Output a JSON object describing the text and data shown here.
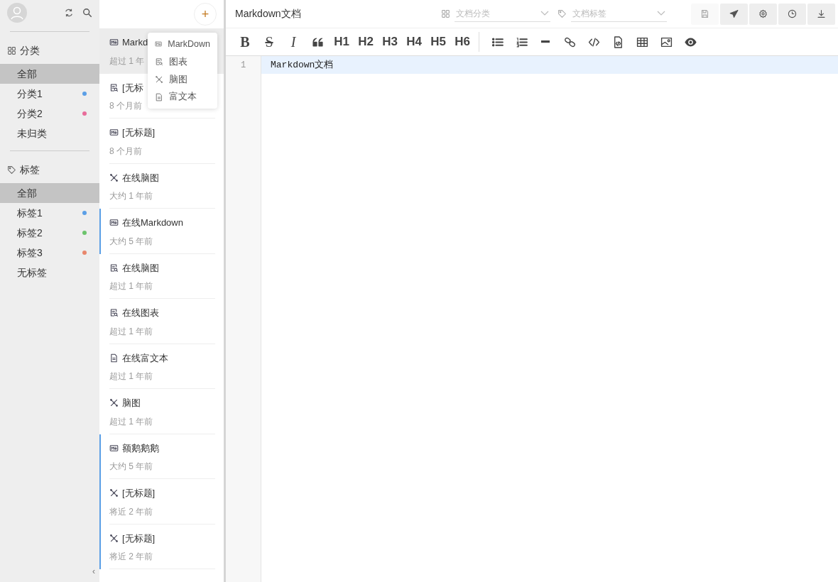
{
  "sidebar": {
    "sections": [
      {
        "kind": "category",
        "title": "分类",
        "items": [
          {
            "label": "全部",
            "selected": true
          },
          {
            "label": "分类1",
            "selected": false,
            "color": "#5b9fe6"
          },
          {
            "label": "分类2",
            "selected": false,
            "color": "#e86c9a"
          },
          {
            "label": "未归类",
            "selected": false
          }
        ]
      },
      {
        "kind": "tag",
        "title": "标签",
        "items": [
          {
            "label": "全部",
            "selected": true
          },
          {
            "label": "标签1",
            "selected": false,
            "color": "#5b9fe6"
          },
          {
            "label": "标签2",
            "selected": false,
            "color": "#6cc46c"
          },
          {
            "label": "标签3",
            "selected": false,
            "color": "#e8876c"
          },
          {
            "label": "无标签",
            "selected": false
          }
        ]
      }
    ]
  },
  "documents": [
    {
      "kind": "markdown",
      "title": "Markd",
      "time": "超过 1 年",
      "selected": true,
      "shared": false
    },
    {
      "kind": "chart",
      "title": "[无标",
      "time": "8 个月前",
      "selected": false,
      "shared": false
    },
    {
      "kind": "markdown",
      "title": "[无标题]",
      "time": "8 个月前",
      "selected": false,
      "shared": false
    },
    {
      "kind": "mindmap",
      "title": "在线脑图",
      "time": "大约 1 年前",
      "selected": false,
      "shared": false
    },
    {
      "kind": "markdown",
      "title": "在线Markdown",
      "time": "大约 5 年前",
      "selected": false,
      "shared": true
    },
    {
      "kind": "chart",
      "title": "在线脑图",
      "time": "超过 1 年前",
      "selected": false,
      "shared": false
    },
    {
      "kind": "chart",
      "title": "在线图表",
      "time": "超过 1 年前",
      "selected": false,
      "shared": false
    },
    {
      "kind": "richtext",
      "title": "在线富文本",
      "time": "超过 1 年前",
      "selected": false,
      "shared": false
    },
    {
      "kind": "mindmap",
      "title": "脑图",
      "time": "超过 1 年前",
      "selected": false,
      "shared": false
    },
    {
      "kind": "markdown",
      "title": "额鹅鹅鹅",
      "time": "大约 5 年前",
      "selected": false,
      "shared": true
    },
    {
      "kind": "mindmap",
      "title": "[无标题]",
      "time": "将近 2 年前",
      "selected": false,
      "shared": true
    },
    {
      "kind": "mindmap",
      "title": "[无标题]",
      "time": "将近 2 年前",
      "selected": false,
      "shared": true
    }
  ],
  "new_menu": {
    "button": "+",
    "items": [
      {
        "kind": "markdown",
        "label": "MarkDown"
      },
      {
        "kind": "chart",
        "label": "图表"
      },
      {
        "kind": "mindmap",
        "label": "脑图"
      },
      {
        "kind": "richtext",
        "label": "富文本"
      }
    ]
  },
  "editor": {
    "title": "Markdown文档",
    "category": {
      "placeholder": "文档分类"
    },
    "tags": {
      "placeholder": "文档标签"
    },
    "actions": [
      {
        "kind": "save",
        "disabled": true
      },
      {
        "kind": "send",
        "disabled": false
      },
      {
        "kind": "settings",
        "disabled": false
      },
      {
        "kind": "history",
        "disabled": false
      },
      {
        "kind": "download",
        "disabled": false
      }
    ],
    "toolbar": [
      {
        "kind": "bold",
        "label": "B"
      },
      {
        "kind": "strike",
        "label": "S"
      },
      {
        "kind": "italic",
        "label": "I"
      },
      {
        "kind": "quote"
      },
      {
        "kind": "heading",
        "label": "H1"
      },
      {
        "kind": "heading",
        "label": "H2"
      },
      {
        "kind": "heading",
        "label": "H3"
      },
      {
        "kind": "heading",
        "label": "H4"
      },
      {
        "kind": "heading",
        "label": "H5"
      },
      {
        "kind": "heading",
        "label": "H6"
      },
      {
        "kind": "separator"
      },
      {
        "kind": "bullets"
      },
      {
        "kind": "numbering"
      },
      {
        "kind": "rule"
      },
      {
        "kind": "link"
      },
      {
        "kind": "code"
      },
      {
        "kind": "codefile"
      },
      {
        "kind": "table"
      },
      {
        "kind": "image"
      },
      {
        "kind": "preview"
      }
    ],
    "lines": [
      {
        "number": "1",
        "text": "Markdown文档",
        "current": true
      }
    ]
  },
  "collapse_button": "‹"
}
